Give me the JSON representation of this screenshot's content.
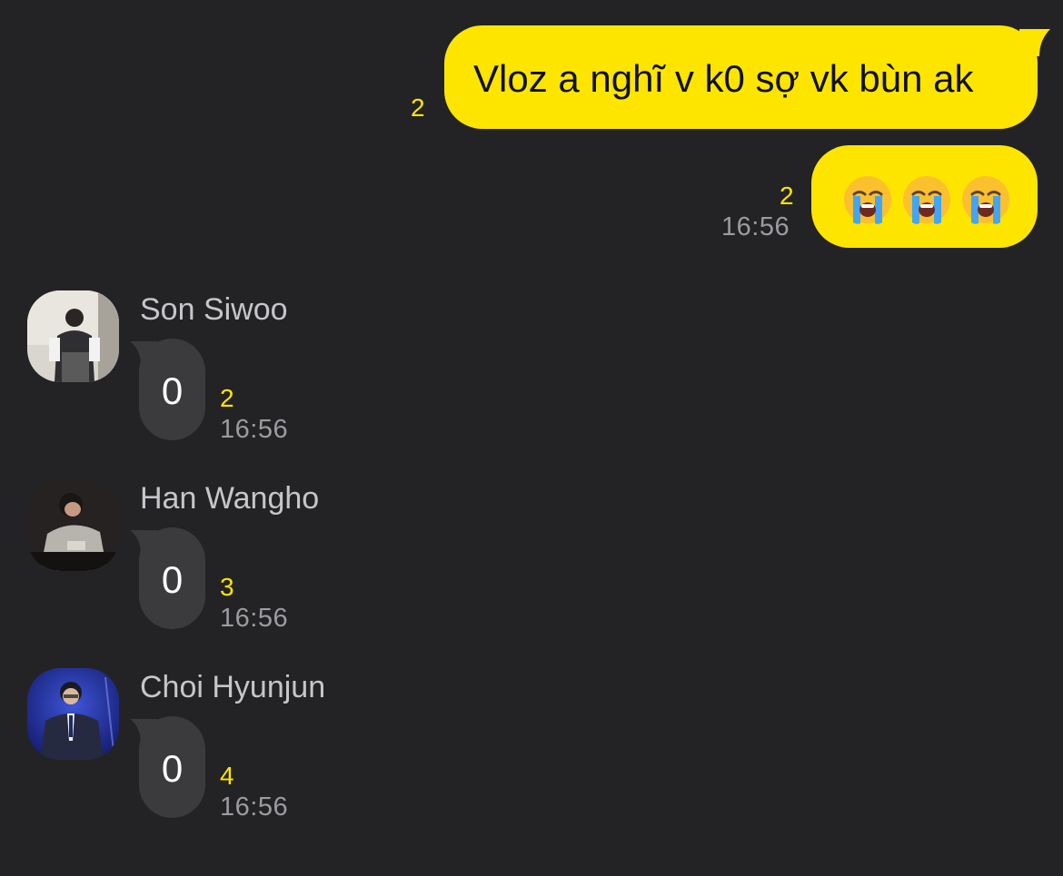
{
  "theme": {
    "background": "#232325",
    "outgoing_bubble": "#fee500",
    "incoming_bubble": "#3b3b3e",
    "unread_color": "#fee500",
    "time_color": "#9b9ba0"
  },
  "outgoing": [
    {
      "text": "Vloz a nghĩ v k0 sợ vk bùn ak",
      "unread": "2",
      "time": ""
    },
    {
      "emoji": [
        "loudly-crying-face",
        "loudly-crying-face",
        "loudly-crying-face"
      ],
      "unread": "2",
      "time": "16:56"
    }
  ],
  "incoming": [
    {
      "sender": "Son Siwoo",
      "avatar": "son-siwoo-avatar",
      "text": "0",
      "unread": "2",
      "time": "16:56"
    },
    {
      "sender": "Han Wangho",
      "avatar": "han-wangho-avatar",
      "text": "0",
      "unread": "3",
      "time": "16:56"
    },
    {
      "sender": "Choi Hyunjun",
      "avatar": "choi-hyunjun-avatar",
      "text": "0",
      "unread": "4",
      "time": "16:56"
    }
  ]
}
